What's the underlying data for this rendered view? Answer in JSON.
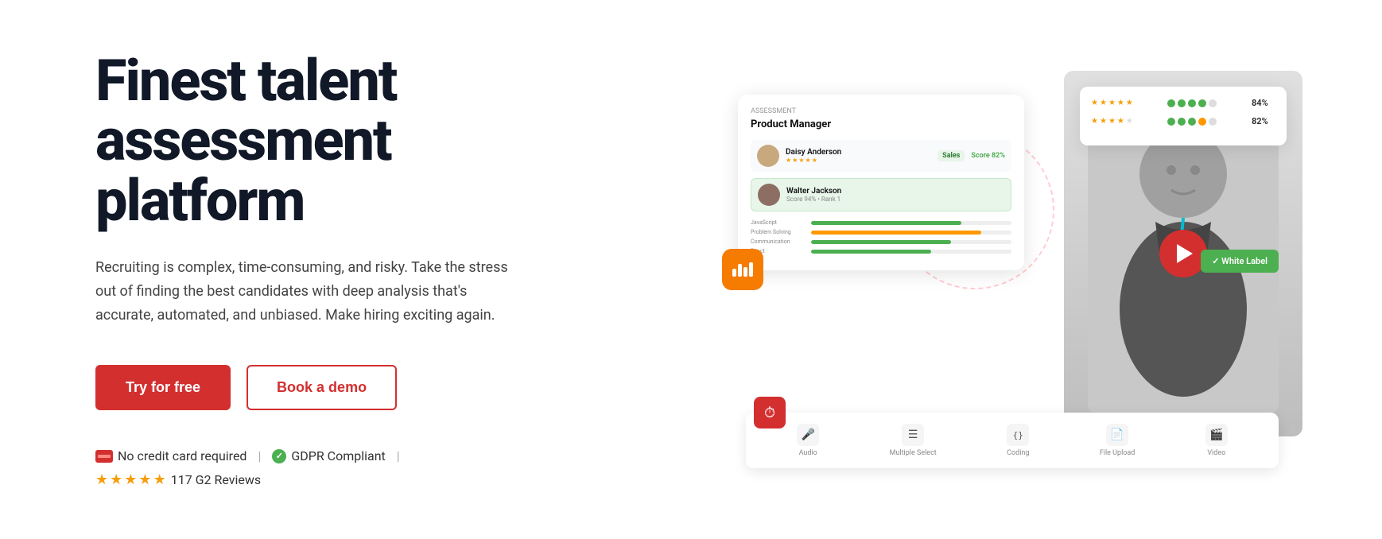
{
  "hero": {
    "headline_line1": "Finest talent",
    "headline_line2": "assessment platform",
    "subtitle": "Recruiting is complex, time-consuming, and risky. Take the stress out of finding the best candidates with deep analysis that's accurate, automated, and unbiased. Make hiring exciting again.",
    "btn_primary": "Try for free",
    "btn_secondary": "Book a demo",
    "trust_no_card": "No credit card required",
    "trust_gdpr": "GDPR Compliant",
    "trust_reviews": "117 G2 Reviews"
  },
  "mockup": {
    "card_label": "Assessment",
    "card_title": "Product Manager",
    "candidates": [
      {
        "name": "Daisy Anderson",
        "meta": "Sales • Score 82%",
        "highlighted": false
      },
      {
        "name": "Walter Jackson",
        "meta": "Score 94% • Rank 1",
        "highlighted": true
      }
    ],
    "scores": [
      {
        "percent": "84%",
        "stars": 5,
        "dots_green": 4,
        "dots_gray": 1
      },
      {
        "percent": "82%",
        "stars": 4,
        "dots_green": 4,
        "dots_gray": 1
      }
    ],
    "progress_bars": [
      {
        "label": "JavaScript",
        "value_green": 75,
        "value_orange": 0
      },
      {
        "label": "React",
        "value_green": 65,
        "value_orange": 0
      },
      {
        "label": "Problem Solving",
        "value_green": 0,
        "value_orange": 85
      },
      {
        "label": "Communication",
        "value_green": 70,
        "value_orange": 0
      }
    ],
    "toolbar_items": [
      {
        "icon": "🎤",
        "label": "Audio"
      },
      {
        "icon": "☰",
        "label": "Multiple Select"
      },
      {
        "icon": "{ }",
        "label": "Coding"
      },
      {
        "icon": "📄",
        "label": "File Upload"
      },
      {
        "icon": "🎬",
        "label": "Video"
      }
    ],
    "white_label_text": "✓ White Label",
    "chart_icon_color": "#f57c00",
    "clock_icon_color": "#d32f2f"
  },
  "colors": {
    "primary_red": "#d32f2f",
    "primary_green": "#4caf50",
    "star_color": "#f59e0b"
  }
}
